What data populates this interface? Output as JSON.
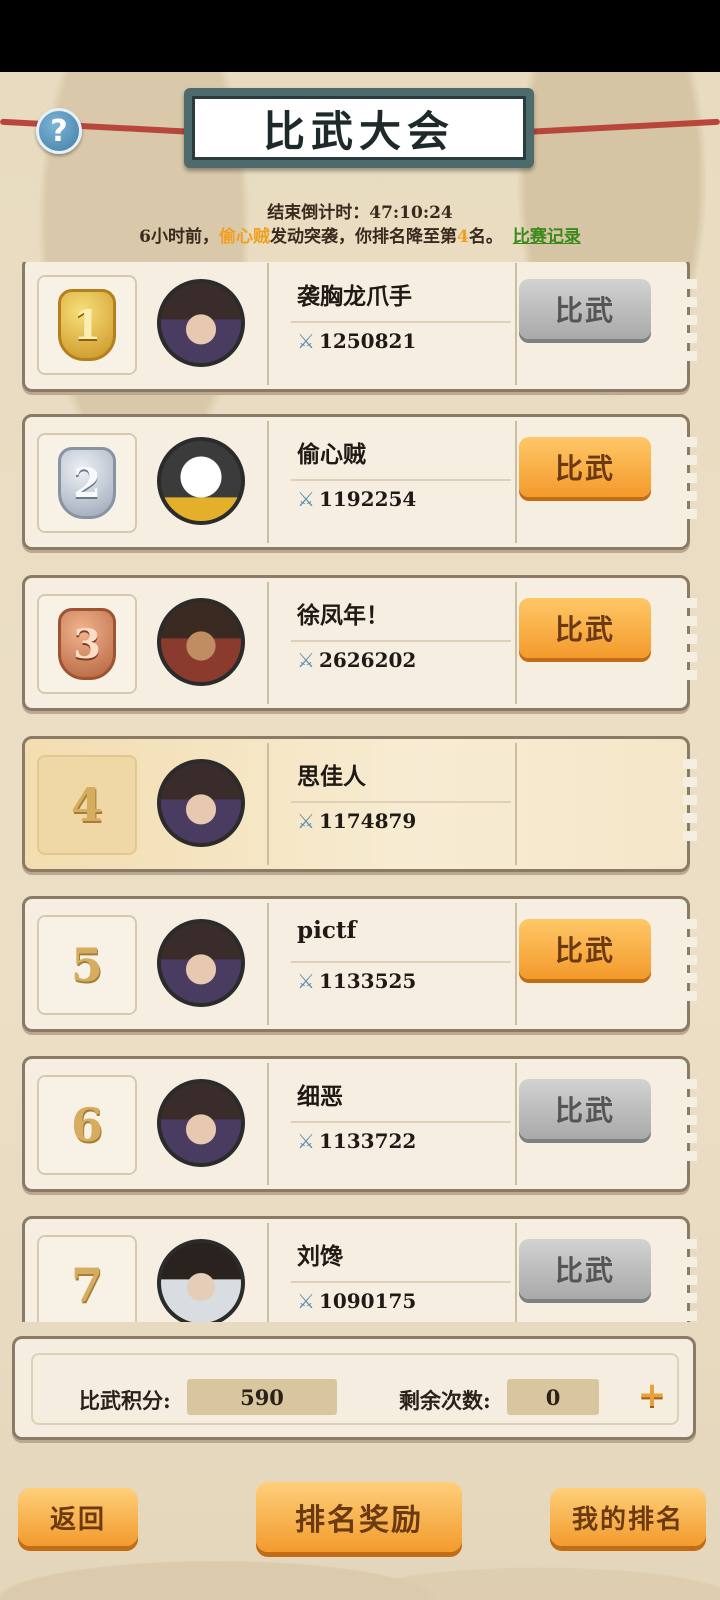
{
  "header": {
    "title": "比武大会",
    "help_label": "?"
  },
  "status": {
    "countdown": "结束倒计时：47:10:24",
    "notice_prefix": "6小时前，",
    "attacker": "偷心贼",
    "notice_middle": "发动突袭，你排名降至第",
    "new_rank": "4",
    "notice_suffix": "名。",
    "record_link": "比赛记录"
  },
  "players": [
    {
      "rank": "1",
      "name": "袭胸龙爪手",
      "power": "1250821",
      "button": "比武",
      "button_state": "disabled",
      "medal": "gold",
      "avatar": "lady"
    },
    {
      "rank": "2",
      "name": "偷心贼",
      "power": "1192254",
      "button": "比武",
      "button_state": "active",
      "medal": "silver",
      "avatar": "panda"
    },
    {
      "rank": "3",
      "name": "徐凤年！",
      "power": "2626202",
      "button": "比武",
      "button_state": "active",
      "medal": "bronze",
      "avatar": "warrior"
    },
    {
      "rank": "4",
      "name": "思佳人",
      "power": "1174879",
      "button": "",
      "button_state": "self",
      "medal": "",
      "avatar": "lady"
    },
    {
      "rank": "5",
      "name": "pictf",
      "power": "1133525",
      "button": "比武",
      "button_state": "active",
      "medal": "",
      "avatar": "lady"
    },
    {
      "rank": "6",
      "name": "细恶",
      "power": "1133722",
      "button": "比武",
      "button_state": "disabled",
      "medal": "",
      "avatar": "lady"
    },
    {
      "rank": "7",
      "name": "刘馋",
      "power": "1090175",
      "button": "比武",
      "button_state": "disabled",
      "medal": "",
      "avatar": "man"
    }
  ],
  "score": {
    "points_label": "比武积分:",
    "points_value": "590",
    "remaining_label": "剩余次数:",
    "remaining_value": "0",
    "add_label": "+"
  },
  "footer": {
    "back": "返回",
    "rewards": "排名奖励",
    "my_rank": "我的排名"
  },
  "colors": {
    "accent_orange": "#f39a2c",
    "link_green": "#3c8a1c",
    "highlight": "#f0a020"
  }
}
